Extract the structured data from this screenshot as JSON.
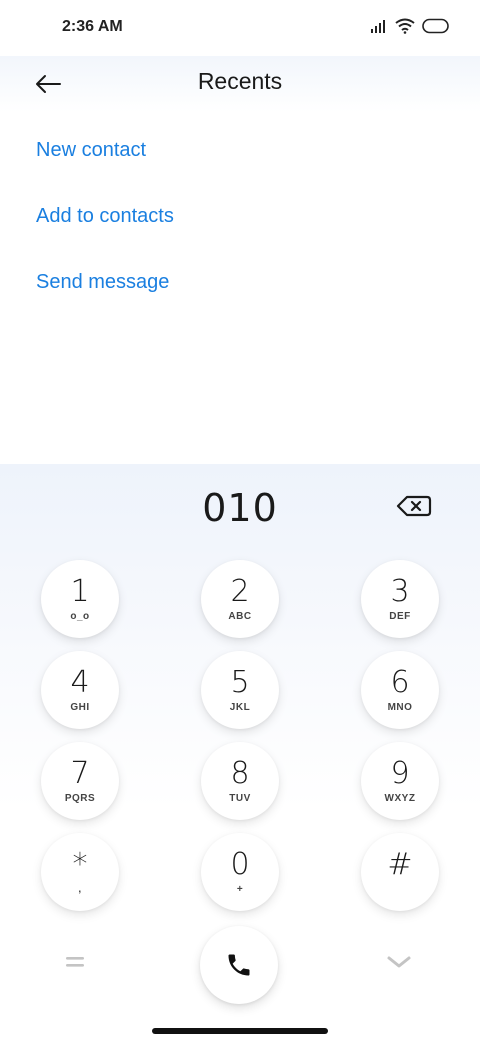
{
  "status_bar": {
    "time": "2:36 AM"
  },
  "header": {
    "title": "Recents"
  },
  "actions": [
    {
      "label": "New contact"
    },
    {
      "label": "Add to contacts"
    },
    {
      "label": "Send message"
    }
  ],
  "dialer": {
    "number": "010",
    "keys": [
      {
        "digit": "1",
        "letters": "o_o"
      },
      {
        "digit": "2",
        "letters": "ABC"
      },
      {
        "digit": "3",
        "letters": "DEF"
      },
      {
        "digit": "4",
        "letters": "GHI"
      },
      {
        "digit": "5",
        "letters": "JKL"
      },
      {
        "digit": "6",
        "letters": "MNO"
      },
      {
        "digit": "7",
        "letters": "PQRS"
      },
      {
        "digit": "8",
        "letters": "TUV"
      },
      {
        "digit": "9",
        "letters": "WXYZ"
      },
      {
        "digit": "*",
        "letters": ","
      },
      {
        "digit": "0",
        "letters": "+"
      },
      {
        "digit": "#",
        "letters": ""
      }
    ]
  },
  "colors": {
    "accent": "#1a7fe0",
    "text": "#1a1a1a"
  },
  "icons": [
    "signal-icon",
    "wifi-icon",
    "battery-icon",
    "back-arrow-icon",
    "backspace-icon",
    "menu-icon",
    "phone-icon",
    "chevron-down-icon"
  ]
}
